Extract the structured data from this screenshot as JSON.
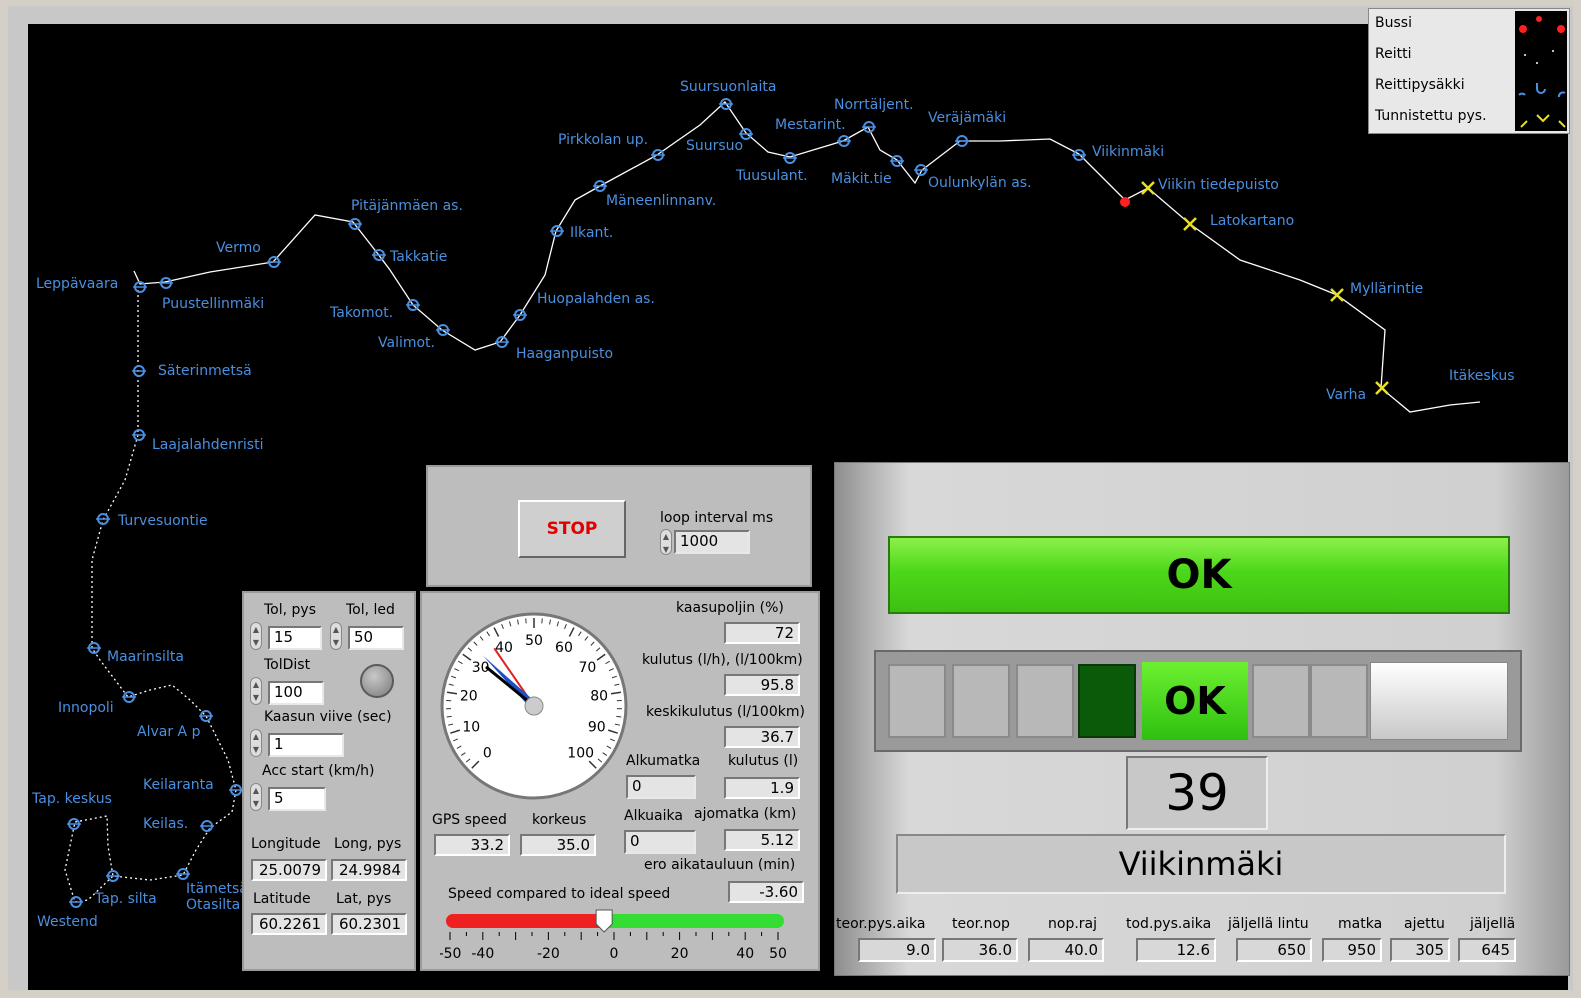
{
  "legend": {
    "items": [
      "Bussi",
      "Reitti",
      "Reittipysäkki",
      "Tunnistettu pys."
    ]
  },
  "map": {
    "stops": [
      "Leppävaara",
      "Puustellinmäki",
      "Vermo",
      "Pitäjänmäen as.",
      "Takkatie",
      "Takomot.",
      "Valimot.",
      "Haaganpuisto",
      "Huopalahden as.",
      "Ilkant.",
      "Mäneenlinnanv.",
      "Pirkkolan up.",
      "Suursuonlaita",
      "Suursuo",
      "Tuusulant.",
      "Mestarint.",
      "Norrtäljent.",
      "Mäkit.tie",
      "Oulunkylän as.",
      "Veräjämäki",
      "Viikinmäki",
      "Viikin tiedepuisto",
      "Latokartano",
      "Myllärintie",
      "Varha",
      "Itäkeskus",
      "Säterinmetsä",
      "Laajalahdenristi",
      "Turvesuontie",
      "Maarinsilta",
      "Innopoli",
      "Alvar A p",
      "Keilaranta",
      "Keilas.",
      "Tap. keskus",
      "Tap. silta",
      "Itämetsä/ Otasilta",
      "Westend"
    ]
  },
  "controls": {
    "stop_label": "STOP",
    "loop_interval_label": "loop interval ms",
    "loop_interval_value": "1000"
  },
  "settings": {
    "tol_pys_label": "Tol, pys",
    "tol_pys_value": "15",
    "tol_led_label": "Tol, led",
    "tol_led_value": "50",
    "toldist_label": "TolDist",
    "toldist_value": "100",
    "kaasun_viive_label": "Kaasun viive (sec)",
    "kaasun_viive_value": "1",
    "acc_start_label": "Acc start (km/h)",
    "acc_start_value": "5",
    "longitude_label": "Longitude",
    "longitude_value": "25.0079",
    "long_pys_label": "Long, pys",
    "long_pys_value": "24.9984",
    "latitude_label": "Latitude",
    "latitude_value": "60.2261",
    "lat_pys_label": "Lat, pys",
    "lat_pys_value": "60.2301"
  },
  "gauge": {
    "ticks": [
      "0",
      "10",
      "20",
      "30",
      "40",
      "50",
      "60",
      "70",
      "80",
      "90",
      "100"
    ],
    "value": 33.2,
    "gps_speed_label": "GPS speed",
    "gps_speed_value": "33.2",
    "korkeus_label": "korkeus",
    "korkeus_value": "35.0"
  },
  "stats": {
    "kaasupoljin_label": "kaasupoljin (%)",
    "kaasupoljin_value": "72",
    "kulutus_label": "kulutus (l/h), (l/100km)",
    "kulutus_value": "95.8",
    "keskikulutus_label": "keskikulutus (l/100km)",
    "keskikulutus_value": "36.7",
    "alkumatka_label": "Alkumatka",
    "alkumatka_value": "0",
    "kulutus_l_label": "kulutus (l)",
    "kulutus_l_value": "1.9",
    "alkuaika_label": "Alkuaika",
    "alkuaika_value": "0",
    "ajomatka_label": "ajomatka (km)",
    "ajomatka_value": "5.12",
    "ero_label": "ero aikatauluun (min)",
    "ero_value": "-3.60"
  },
  "speed_bar": {
    "title": "Speed compared to ideal speed",
    "ticks": [
      "-50",
      "-40",
      "-20",
      "0",
      "20",
      "40",
      "50"
    ],
    "value": -3
  },
  "status": {
    "main": "OK",
    "led_label": "OK",
    "count": "39",
    "stop_name": "Viikinmäki",
    "bottom_labels": [
      "teor.pys.aika",
      "teor.nop",
      "nop.raj",
      "tod.pys.aika",
      "jäljellä lintu",
      "matka",
      "ajettu",
      "jäljellä"
    ],
    "bottom_values": [
      "9.0",
      "36.0",
      "40.0",
      "12.6",
      "650",
      "950",
      "305",
      "645"
    ]
  },
  "colors": {
    "route": "#ffffff",
    "stop_label": "#4a8fe0",
    "bus": "#ff2020",
    "identified": "#e8e020",
    "ok_green": "#4cd81a",
    "stop_text": "#e00000"
  }
}
